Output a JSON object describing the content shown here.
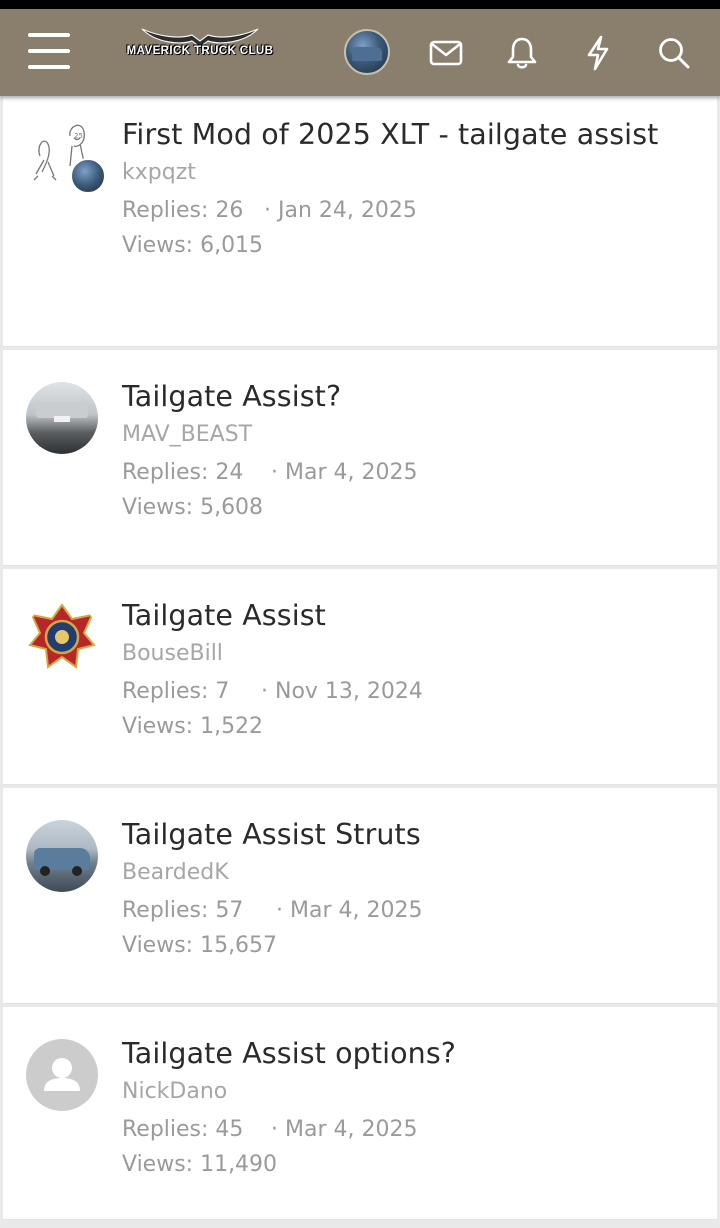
{
  "header": {
    "logo_text": "MAVERICK TRUCK CLUB",
    "brand_color": "#8a7e6c",
    "icons": [
      "menu-icon",
      "avatar",
      "envelope-icon",
      "bell-icon",
      "lightning-icon",
      "search-icon"
    ]
  },
  "threads": [
    {
      "title": "First Mod of 2025 XLT - tailgate assist",
      "starter": "kxpqzt",
      "replies": "Replies: 26",
      "date": "· Jan 24, 2025",
      "views": "Views: 6,015"
    },
    {
      "title": "Tailgate Assist?",
      "starter": "MAV_BEAST",
      "replies": "Replies: 24",
      "date": "· Mar 4, 2025",
      "views": "Views: 5,608"
    },
    {
      "title": "Tailgate Assist",
      "starter": "BouseBill",
      "replies": "Replies: 7",
      "date": "· Nov 13, 2024",
      "views": "Views: 1,522"
    },
    {
      "title": "Tailgate Assist Struts",
      "starter": "BeardedK",
      "replies": "Replies: 57",
      "date": "· Mar 4, 2025",
      "views": "Views: 15,657"
    },
    {
      "title": "Tailgate Assist options?",
      "starter": "NickDano",
      "replies": "Replies: 45",
      "date": "· Mar 4, 2025",
      "views": "Views: 11,490"
    }
  ]
}
